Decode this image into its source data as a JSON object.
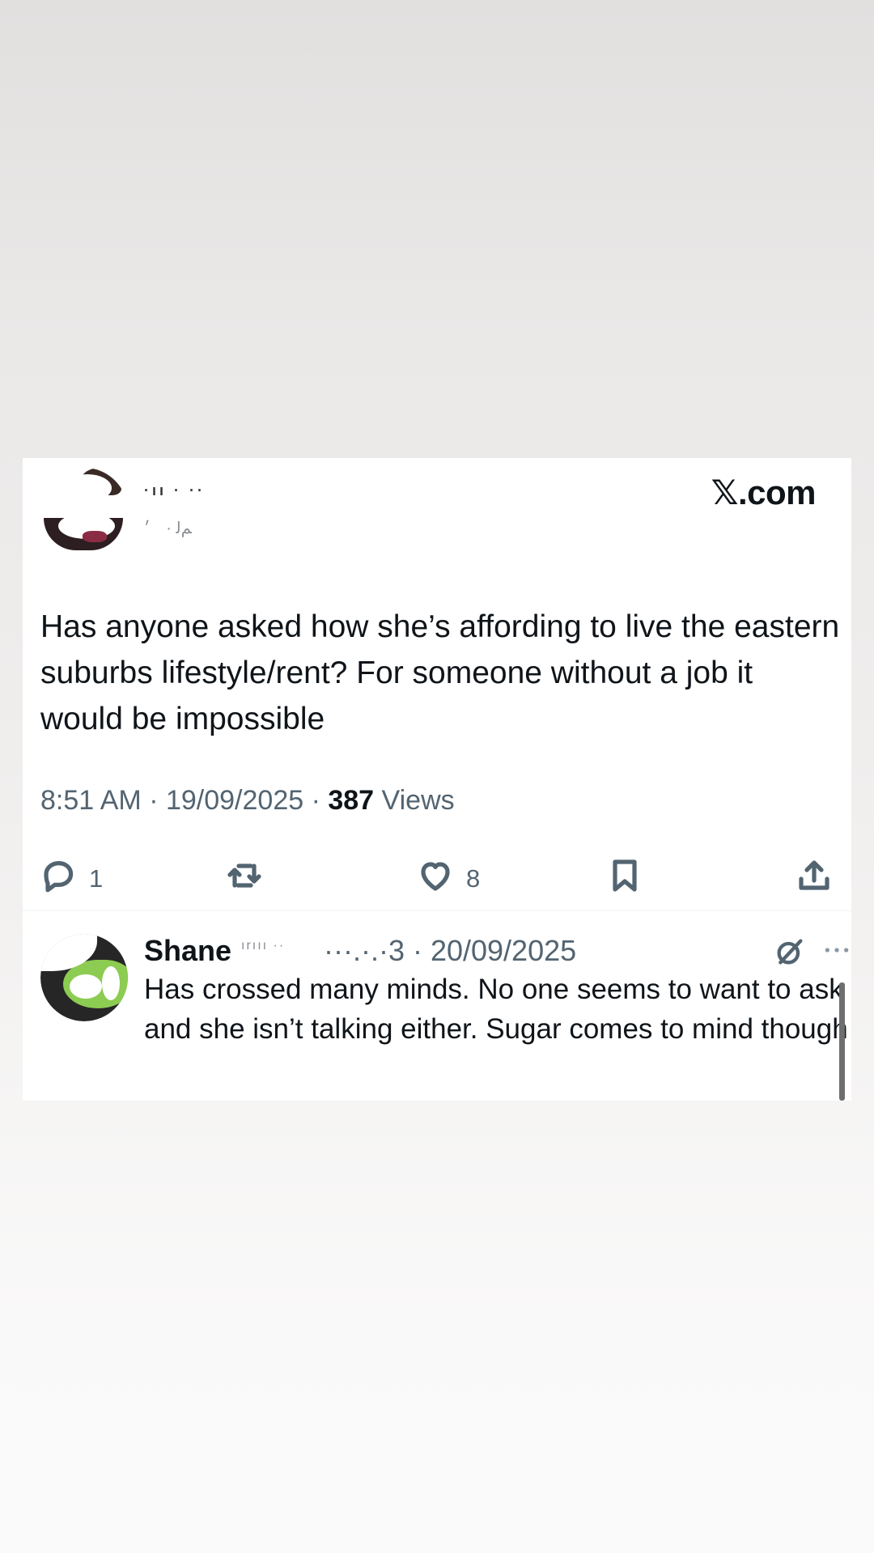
{
  "site": "𝕏.com",
  "tweet": {
    "author_name_blurred": "·ıı  ·  ··",
    "author_handle_blurred": "ﻢﻟ  ·  ׳",
    "text": "Has anyone asked how she’s affording to live the eastern suburbs lifestyle/rent? For someone without a job it would be impossible",
    "time": "8:51 AM",
    "date": "19/09/2025",
    "views_count": "387",
    "views_label": "Views",
    "separator": " · "
  },
  "actions": {
    "reply_count": "1",
    "like_count": "8"
  },
  "reply": {
    "name": "Shane",
    "handle_blurred": "ırııı ··",
    "date_text": "···.·.·3 · 20/09/2025",
    "text": "Has crossed many minds. No one seems to want to ask and she isn’t talking either. Sugar comes to mind though"
  },
  "icons": {
    "reply": "reply-bubble-icon",
    "retweet": "retweet-icon",
    "like": "heart-icon",
    "bookmark": "bookmark-icon",
    "share": "share-upload-icon",
    "grok": "grok-icon",
    "more": "more-dots-icon"
  },
  "colors": {
    "text_primary": "#0f1419",
    "text_secondary": "#536471",
    "card_bg": "#ffffff"
  }
}
